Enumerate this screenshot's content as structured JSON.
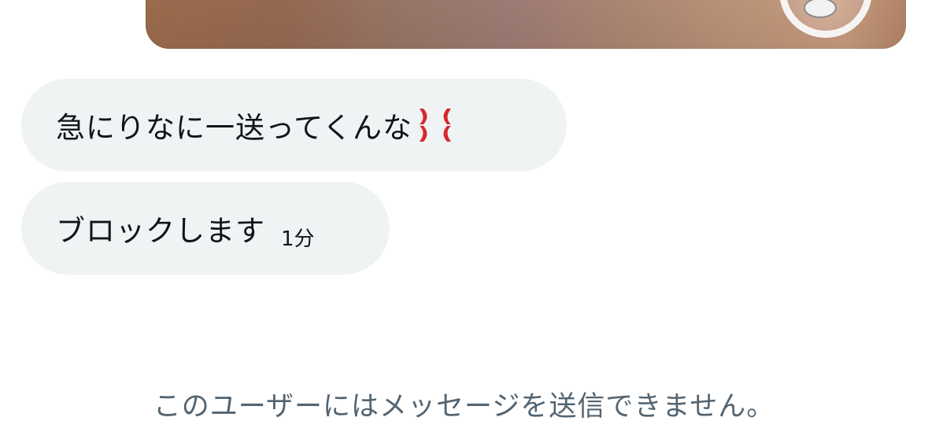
{
  "messages": [
    {
      "text": "急にりなに一送ってくんな",
      "emoji": "anger-icon"
    },
    {
      "text": "ブロックします",
      "time": "1分"
    }
  ],
  "notice": "このユーザーにはメッセージを送信できません。",
  "colors": {
    "bubble_bg": "#eff3f4",
    "text": "#0f1419",
    "notice_text": "#536471",
    "anger": "#d8272e"
  }
}
